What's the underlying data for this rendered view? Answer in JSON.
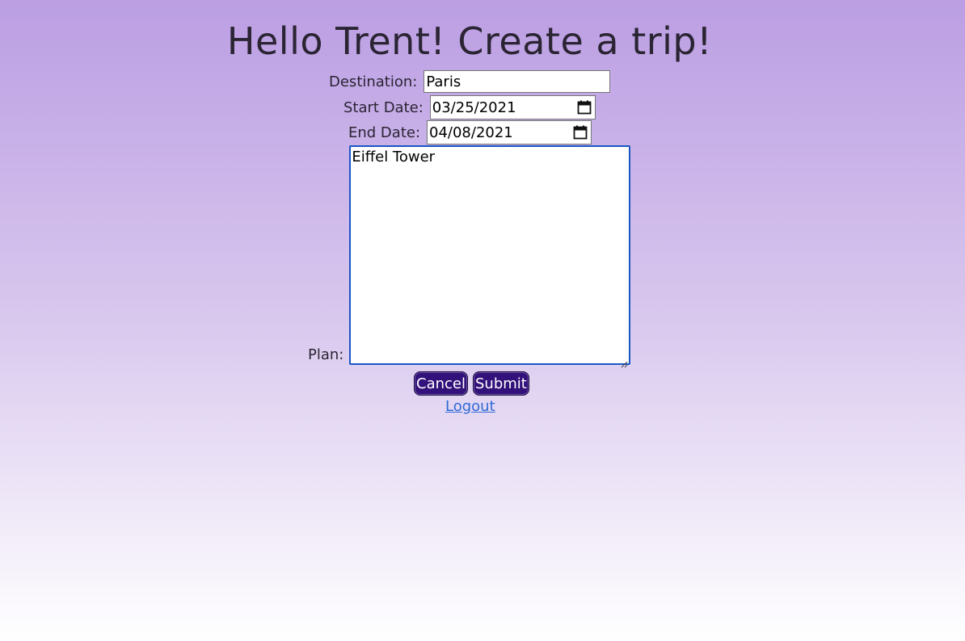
{
  "header": {
    "title": "Hello Trent! Create a trip!"
  },
  "form": {
    "destination_label": "Destination:",
    "destination_value": "Paris",
    "start_date_label": "Start Date:",
    "start_date_value": "03/25/2021",
    "end_date_label": "End Date:",
    "end_date_value": "04/08/2021",
    "plan_label": "Plan:",
    "plan_value": "Eiffel Tower"
  },
  "buttons": {
    "cancel_label": "Cancel",
    "submit_label": "Submit"
  },
  "links": {
    "logout_label": "Logout"
  },
  "icons": {
    "calendar": "calendar-icon",
    "resize": "resize-grip-icon"
  },
  "colors": {
    "gradient_top": "#bb9ee3",
    "gradient_bottom": "#ffffff",
    "button_bg": "#33117a",
    "link": "#2f6ad6",
    "focus_border": "#1a56c4"
  }
}
